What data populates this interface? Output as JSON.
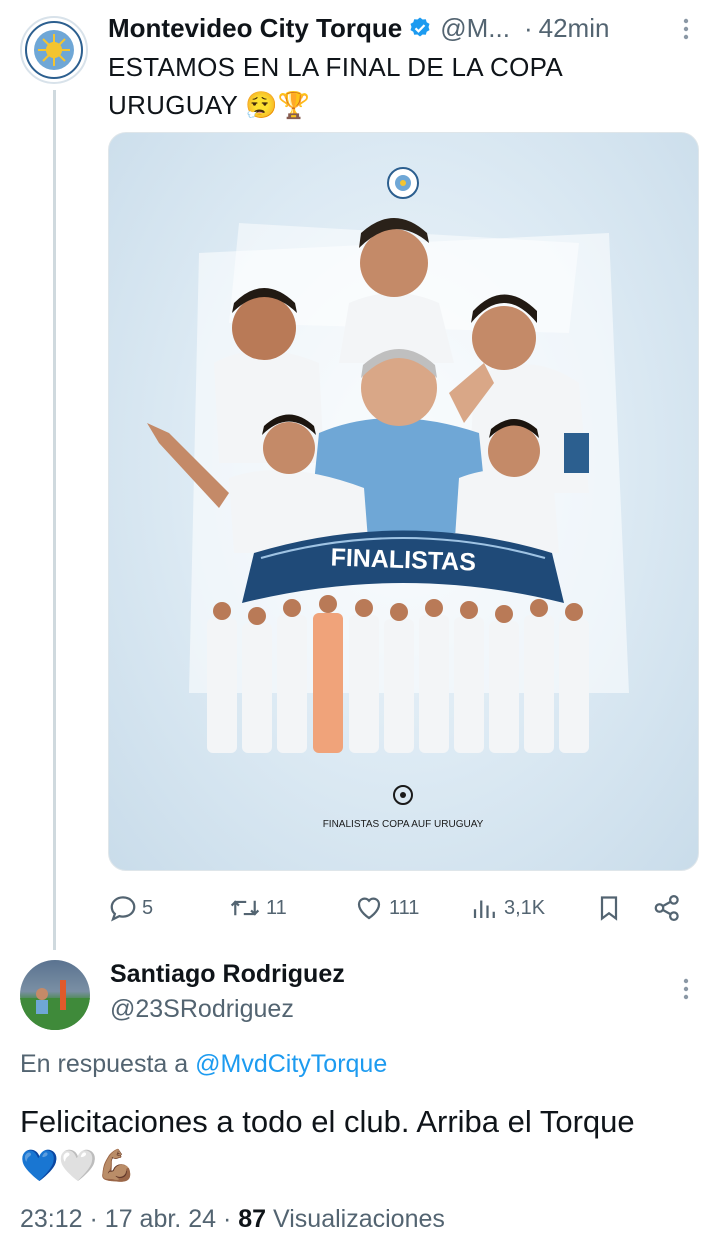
{
  "tweet": {
    "author_name": "Montevideo City Torque",
    "author_handle": "@M...",
    "time": "42min",
    "text": "ESTAMOS EN LA FINAL DE LA COPA URUGUAY 😮‍💨🏆",
    "media": {
      "banner": "FINALISTAS",
      "caption": "FINALISTAS COPA AUF URUGUAY"
    },
    "actions": {
      "replies": "5",
      "retweets": "11",
      "likes": "111",
      "views": "3,1K"
    }
  },
  "reply": {
    "author_name": "Santiago Rodriguez",
    "author_handle": "@23SRodriguez",
    "in_reply_prefix": "En respuesta a",
    "in_reply_mention": "@MvdCityTorque",
    "text": "Felicitaciones a todo el club. Arriba el Torque",
    "emojis": "💙🤍💪🏽",
    "time": "23:12",
    "date": "17 abr. 24",
    "views_count": "87",
    "views_label": "Visualizaciones"
  },
  "colors": {
    "accent": "#1d9bf0",
    "muted": "#536471",
    "kit_blue": "#2c5f8f",
    "banner_navy": "#1f4a78"
  },
  "icons": [
    "verified-badge-icon",
    "more-icon",
    "reply-icon",
    "retweet-icon",
    "like-icon",
    "views-icon",
    "bookmark-icon",
    "share-icon"
  ]
}
